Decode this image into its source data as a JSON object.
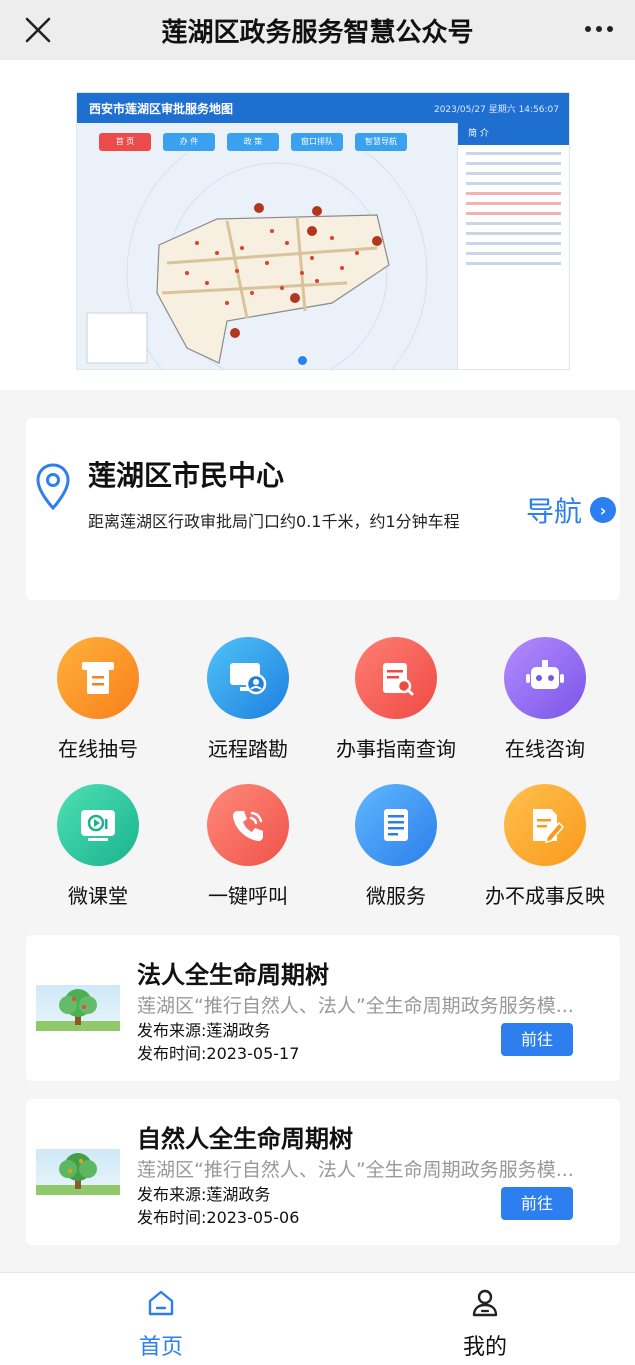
{
  "header": {
    "title": "莲湖区政务服务智慧公众号",
    "close_icon": "close-icon",
    "more_icon": "more-dots-icon"
  },
  "banner": {
    "image_title": "西安市莲湖区审批服务地图",
    "image_time": "2023/05/27 星期六 14:56:07",
    "tabs": [
      "首 页",
      "办 件",
      "政 策",
      "窗口排队",
      "智慧导航"
    ],
    "side_title": "简 介",
    "active_slide": 1
  },
  "location": {
    "icon": "location-pin-icon",
    "title": "莲湖区市民中心",
    "description": "距离莲湖区行政审批局门口约0.1千米，约1分钟车程",
    "nav_label": "导航",
    "nav_icon": "chevron-right-circle-icon",
    "accent_color": "#2d7ff0"
  },
  "services": [
    {
      "label": "在线抽号",
      "icon": "ticket-queue-icon"
    },
    {
      "label": "远程踏勘",
      "icon": "remote-video-inspection-icon"
    },
    {
      "label": "办事指南查询",
      "icon": "guide-search-icon"
    },
    {
      "label": "在线咨询",
      "icon": "robot-chat-icon"
    },
    {
      "label": "微课堂",
      "icon": "video-class-icon"
    },
    {
      "label": "一键呼叫",
      "icon": "phone-call-icon"
    },
    {
      "label": "微服务",
      "icon": "document-list-icon"
    },
    {
      "label": "办不成事反映",
      "icon": "edit-feedback-icon"
    }
  ],
  "news": [
    {
      "title": "法人全生命周期树",
      "summary": "莲湖区“推行自然人、法人”全生命周期政务服务模...",
      "source": "发布来源:莲湖政务",
      "date": "发布时间:2023-05-17",
      "button": "前往",
      "thumb_icon": "tree-icon"
    },
    {
      "title": "自然人全生命周期树",
      "summary": "莲湖区“推行自然人、法人”全生命周期政务服务模...",
      "source": "发布来源:莲湖政务",
      "date": "发布时间:2023-05-06",
      "button": "前往",
      "thumb_icon": "tree-icon"
    }
  ],
  "tabbar": {
    "home": {
      "label": "首页",
      "icon": "home-icon",
      "active": true,
      "color": "#2d7ff0"
    },
    "mine": {
      "label": "我的",
      "icon": "user-icon",
      "active": false,
      "color": "#111111"
    }
  }
}
